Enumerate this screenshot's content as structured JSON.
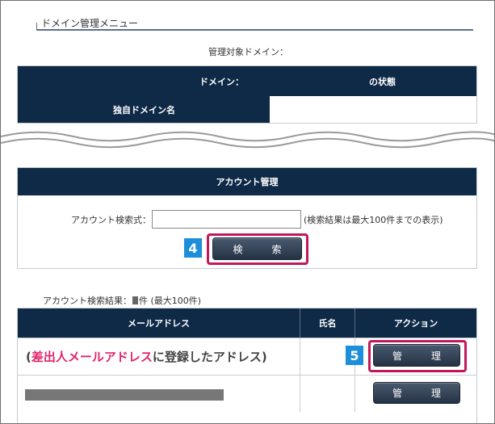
{
  "menu": {
    "title": "ドメイン管理メニュー"
  },
  "domain_section": {
    "target_label": "管理対象ドメイン：",
    "header_left": "ドメイン：",
    "header_right": "の状態",
    "row_label": "独自ドメイン名"
  },
  "account_section": {
    "header": "アカウント管理",
    "search_label": "アカウント検索式：",
    "search_value": "",
    "search_hint": "(検索結果は最大100件までの表示)",
    "search_button": "検　索",
    "step_badge": "4"
  },
  "results": {
    "label_prefix": "アカウント検索結果：",
    "label_suffix": "件 (最大100件)",
    "columns": [
      "メールアドレス",
      "氏名",
      "アクション"
    ],
    "rows": [
      {
        "note_open": "(",
        "note_highlight": "差出人メールアドレス",
        "note_rest": "に登録したアドレス)",
        "action": "管　理",
        "step_badge": "5"
      },
      {
        "action": "管　理"
      }
    ]
  },
  "colors": {
    "header_navy": "#0f2a47",
    "highlight_pink": "#c2185b",
    "badge_blue": "#1d8ed9"
  }
}
